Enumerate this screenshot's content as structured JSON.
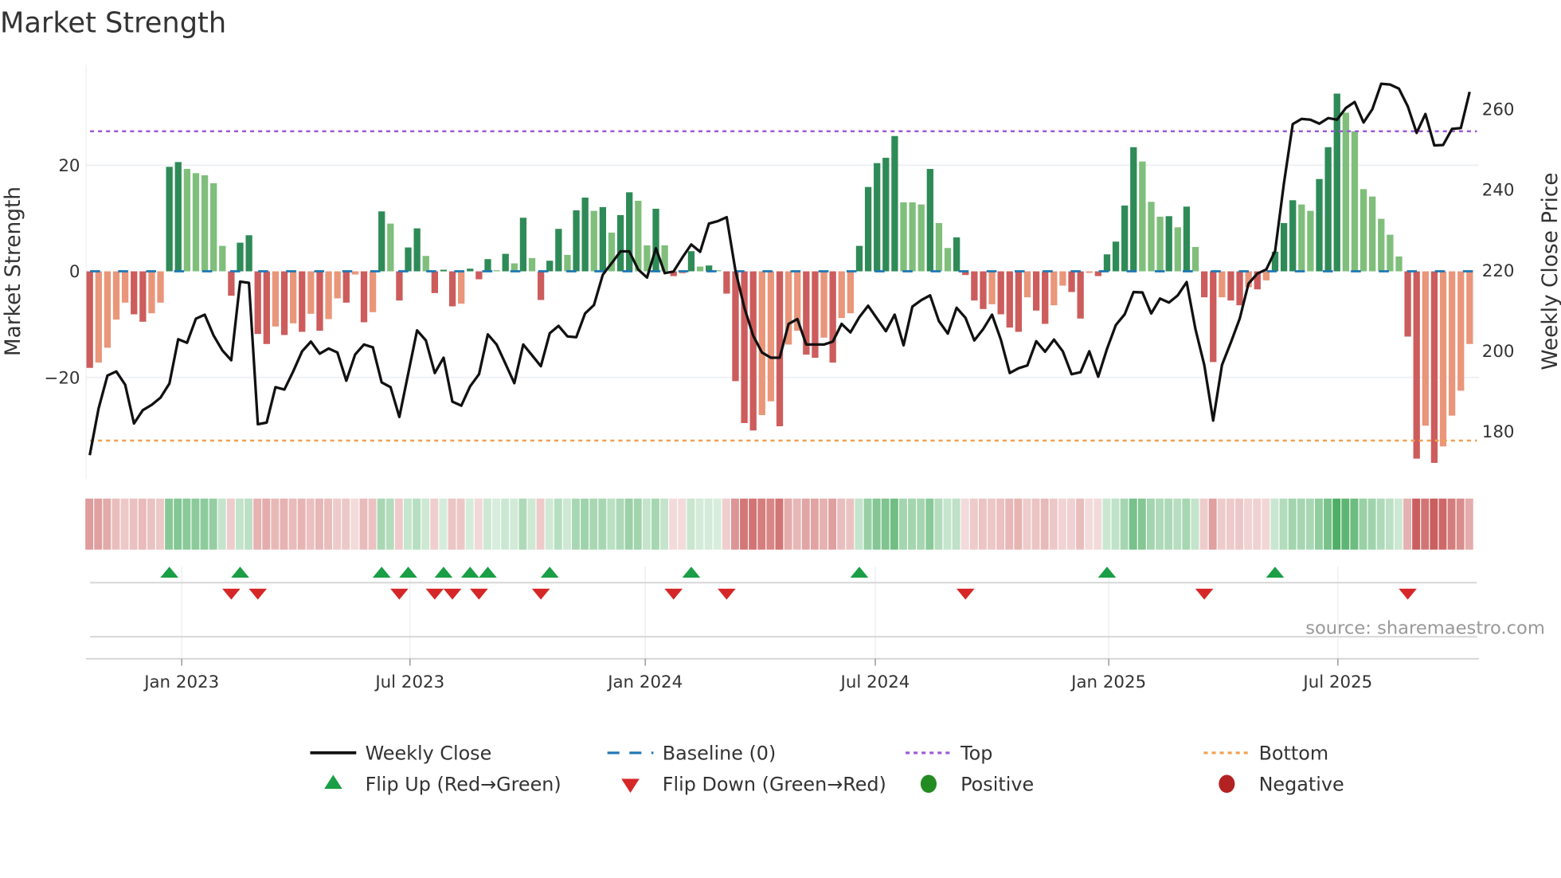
{
  "chart_data": {
    "type": "bar",
    "title": "Market Strength",
    "ylabel": "Market Strength",
    "y2label": "Weekly Close Price",
    "ylim": [
      -39,
      39
    ],
    "y2lim": [
      167,
      270
    ],
    "y_ticks": [
      {
        "label": "20",
        "value": 20
      },
      {
        "label": "0",
        "value": 0
      },
      {
        "label": "−20",
        "value": -20
      }
    ],
    "y2_ticks": [
      {
        "label": "180",
        "value": 180
      },
      {
        "label": "200",
        "value": 200
      },
      {
        "label": "220",
        "value": 220
      },
      {
        "label": "240",
        "value": 240
      },
      {
        "label": "260",
        "value": 260
      }
    ],
    "x_ticks": [
      {
        "label": "Jan 2023",
        "week": 10.4
      },
      {
        "label": "Jul 2023",
        "week": 36.2
      },
      {
        "label": "Jan 2024",
        "week": 62.8
      },
      {
        "label": "Jul 2024",
        "week": 88.8
      },
      {
        "label": "Jan 2025",
        "week": 115.2
      },
      {
        "label": "Jul 2025",
        "week": 141.1
      }
    ],
    "top_level": 26.4,
    "bottom_level": -31.9,
    "baseline": 0,
    "grid": true,
    "legend_position": "bottom",
    "strength": [
      -18.2,
      -17.2,
      -14.4,
      -9.1,
      -5.9,
      -8.1,
      -9.5,
      -7.9,
      -5.9,
      19.7,
      20.6,
      19.3,
      18.5,
      18.1,
      16.6,
      4.8,
      -4.6,
      5.4,
      6.8,
      -11.8,
      -13.7,
      -10.4,
      -12.0,
      -9.8,
      -11.4,
      -8.0,
      -11.2,
      -9.0,
      -5.1,
      -5.9,
      -0.6,
      -9.6,
      -7.7,
      11.3,
      9.0,
      -5.5,
      4.5,
      8.1,
      2.9,
      -4.1,
      0.3,
      -6.6,
      -6.1,
      0.5,
      -1.5,
      2.3,
      0.2,
      3.3,
      1.5,
      10.1,
      2.5,
      -5.4,
      2.0,
      8.0,
      3.1,
      11.5,
      13.9,
      11.4,
      12.1,
      7.3,
      10.6,
      14.9,
      13.3,
      4.9,
      11.8,
      4.9,
      -0.9,
      -0.4,
      3.8,
      0.9,
      1.1,
      0.2,
      -4.2,
      -20.7,
      -28.6,
      -30.0,
      -27.1,
      -24.5,
      -29.2,
      -13.8,
      -11.2,
      -15.7,
      -16.3,
      -12.5,
      -17.2,
      -8.8,
      -7.9,
      4.8,
      15.9,
      20.4,
      21.4,
      25.5,
      13.0,
      13.0,
      12.6,
      19.3,
      9.1,
      4.4,
      6.4,
      -0.7,
      -5.5,
      -7.1,
      -6.2,
      -8.1,
      -10.6,
      -11.4,
      -4.9,
      -7.4,
      -9.9,
      -6.4,
      -2.7,
      -3.9,
      -8.9,
      -0.3,
      -0.9,
      3.2,
      5.6,
      12.4,
      23.4,
      20.7,
      13.1,
      10.3,
      10.4,
      8.3,
      12.2,
      4.6,
      -4.9,
      -17.1,
      -4.9,
      -5.5,
      -6.4,
      -3.0,
      -3.4,
      -1.7,
      3.7,
      9.1,
      13.4,
      12.6,
      11.4,
      17.4,
      23.4,
      33.5,
      29.9,
      26.4,
      15.5,
      14.1,
      9.9,
      6.9,
      2.8,
      -12.3,
      -35.3,
      -29.1,
      -36.1,
      -33.0,
      -27.2,
      -22.5,
      -13.7
    ],
    "weekly_close": [
      174.1,
      185.7,
      193.9,
      194.9,
      191.6,
      182.0,
      185.3,
      186.6,
      188.4,
      191.9,
      202.9,
      202.0,
      208.0,
      209.0,
      203.8,
      200.1,
      197.7,
      217.2,
      216.9,
      181.8,
      182.2,
      191.0,
      190.4,
      194.9,
      199.9,
      202.3,
      199.3,
      200.6,
      199.6,
      192.6,
      199.1,
      201.6,
      200.9,
      192.2,
      191.0,
      183.6,
      194.3,
      205.1,
      202.6,
      194.5,
      198.3,
      187.4,
      186.4,
      191.2,
      194.2,
      204.1,
      201.6,
      196.8,
      192.0,
      201.6,
      198.9,
      196.2,
      204.4,
      206.2,
      203.6,
      203.4,
      209.3,
      211.4,
      218.9,
      221.8,
      224.7,
      224.7,
      220.2,
      218.2,
      225.5,
      219.3,
      219.7,
      223.2,
      226.4,
      224.6,
      231.6,
      232.2,
      233.2,
      219.9,
      210.7,
      203.8,
      199.6,
      198.3,
      198.3,
      206.7,
      207.9,
      201.6,
      201.6,
      201.6,
      202.3,
      206.7,
      204.6,
      208.4,
      211.2,
      208.0,
      204.9,
      209.0,
      201.4,
      211.0,
      212.6,
      213.8,
      207.4,
      204.3,
      210.7,
      208.2,
      202.6,
      205.4,
      209.0,
      202.8,
      194.5,
      195.7,
      196.4,
      202.4,
      199.8,
      202.8,
      199.9,
      194.2,
      194.7,
      199.9,
      193.6,
      200.5,
      206.4,
      209.1,
      214.6,
      214.5,
      209.3,
      213.0,
      212.0,
      213.8,
      217.1,
      205.4,
      196.5,
      182.7,
      196.5,
      202.1,
      208.0,
      216.7,
      219.2,
      220.2,
      224.8,
      241.6,
      256.3,
      257.6,
      257.4,
      256.4,
      257.8,
      257.4,
      260.3,
      261.8,
      256.7,
      260.0,
      266.3,
      266.1,
      265.1,
      260.7,
      254.1,
      258.8,
      251.0,
      251.1,
      255.1,
      255.3,
      264.3
    ],
    "colors": {
      "positive_rising": "#2e8b57",
      "positive_falling": "#7fbf7b",
      "negative_falling": "#cd5c5c",
      "negative_rising": "#e9967a",
      "baseline": "#1f77b4",
      "top": "#9b59d6",
      "bottom": "#f0a050",
      "flip_up": "#1a9e46",
      "flip_down": "#d62728",
      "positive": "#228b22",
      "negative": "#b22222",
      "line": "#111111"
    },
    "legend": [
      {
        "label": "Weekly Close",
        "symbol": "line"
      },
      {
        "label": "Baseline (0)",
        "symbol": "dash"
      },
      {
        "label": "Top",
        "symbol": "dot-purple"
      },
      {
        "label": "Bottom",
        "symbol": "dot-orange"
      },
      {
        "label": "Flip Up (Red→Green)",
        "symbol": "triangle-up"
      },
      {
        "label": "Flip Down (Green→Red)",
        "symbol": "triangle-down"
      },
      {
        "label": "Positive",
        "symbol": "circle-green"
      },
      {
        "label": "Negative",
        "symbol": "circle-red"
      }
    ],
    "source": "source: sharemaestro.com"
  }
}
